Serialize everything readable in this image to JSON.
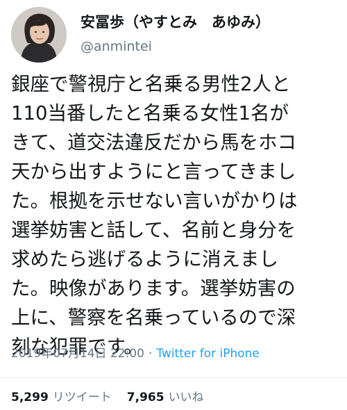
{
  "user": {
    "display_name": "安冨歩（やすとみ　あゆみ）",
    "handle": "@anmintei",
    "avatar_icon": "profile-photo-avatar"
  },
  "tweet": {
    "lines": [
      "銀座で警視庁と名乗る男性2人と",
      "110当番したと名乗る女性1名が",
      "きて、道交法違反だから馬をホコ",
      "天から出すようにと言ってきまし",
      "た。根拠を示せない言いがかりは",
      "選挙妨害と話して、名前と身分を",
      "求めたら逃げるように消えまし",
      "た。映像があります。選挙妨害の",
      "上に、警察を名乗っているので深",
      "刻な犯罪です。"
    ]
  },
  "meta": {
    "timestamp": "2019年07月14日 22:00",
    "separator": "·",
    "source": "Twitter for iPhone"
  },
  "stats": {
    "retweet_count": "5,299",
    "retweet_label": "リツイート",
    "like_count": "7,965",
    "like_label": "いいね"
  },
  "colors": {
    "text": "#14171a",
    "secondary": "#657786",
    "link": "#1da1f2",
    "divider": "#e6ecf0"
  }
}
